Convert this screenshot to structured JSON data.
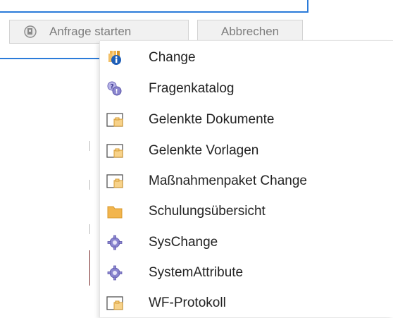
{
  "background_dialog": {
    "start_button_label": "Anfrage starten",
    "cancel_button_label": "Abbrechen"
  },
  "menu": {
    "items": [
      {
        "label": "Change",
        "icon": "change-info-icon"
      },
      {
        "label": "Fragenkatalog",
        "icon": "question-catalog-icon"
      },
      {
        "label": "Gelenkte Dokumente",
        "icon": "document-frame-icon"
      },
      {
        "label": "Gelenkte Vorlagen",
        "icon": "document-frame-icon"
      },
      {
        "label": "Maßnahmenpaket Change",
        "icon": "document-frame-icon"
      },
      {
        "label": "Schulungsübersicht",
        "icon": "folder-icon"
      },
      {
        "label": "SysChange",
        "icon": "gear-icon"
      },
      {
        "label": "SystemAttribute",
        "icon": "gear-icon"
      },
      {
        "label": "WF-Protokoll",
        "icon": "document-frame-icon"
      }
    ]
  },
  "colors": {
    "accent_blue": "#2b7bd9",
    "folder_orange": "#f2b54d",
    "gear_purple": "#8b86cf",
    "info_blue": "#1f5fb8"
  }
}
